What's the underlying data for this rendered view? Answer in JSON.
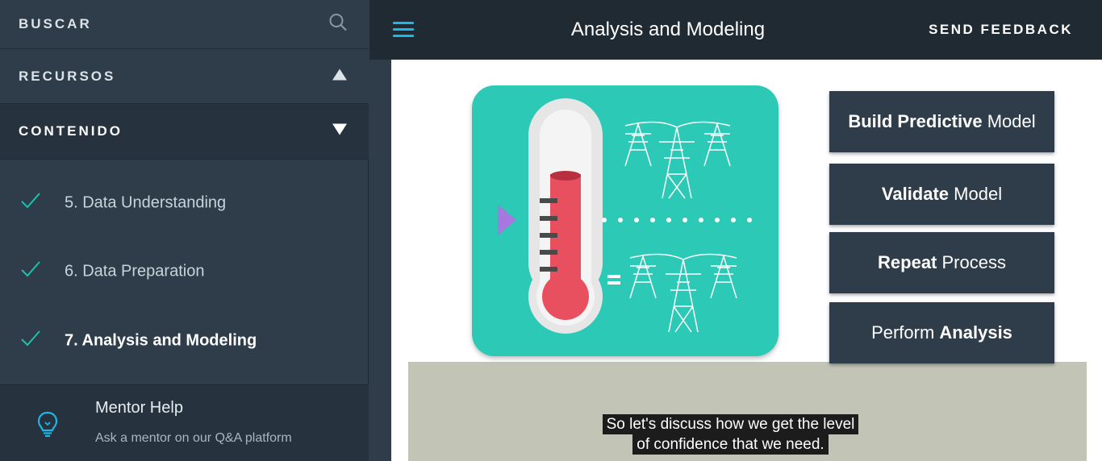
{
  "sidebar": {
    "search_label": "BUSCAR",
    "resources_label": "RECURSOS",
    "content_label": "CONTENIDO",
    "lessons": [
      {
        "label": "5. Data Understanding",
        "completed": true,
        "active": false
      },
      {
        "label": "6. Data Preparation",
        "completed": true,
        "active": false
      },
      {
        "label": "7. Analysis and Modeling",
        "completed": true,
        "active": true
      }
    ],
    "mentor": {
      "title": "Mentor Help",
      "subtitle": "Ask a mentor on our Q&A platform",
      "icon": "lightbulb-icon"
    }
  },
  "header": {
    "title": "Analysis and Modeling",
    "feedback_label": "SEND FEEDBACK"
  },
  "video": {
    "steps": [
      {
        "bold": "Build Predictive",
        "normal": " Model",
        "bold_first": true
      },
      {
        "bold": "Validate",
        "normal": " Model",
        "bold_first": true
      },
      {
        "bold": "Repeat",
        "normal": " Process",
        "bold_first": true
      },
      {
        "bold": "Analysis",
        "normal": "Perform ",
        "bold_first": false
      }
    ],
    "caption_line1": "So let's discuss how we get the level",
    "caption_line2": "of confidence that we need."
  },
  "colors": {
    "accent": "#1cb6e8",
    "check": "#1bc2ad",
    "sidebar": "#2e3d49",
    "illustration": "#2bc9b6"
  }
}
